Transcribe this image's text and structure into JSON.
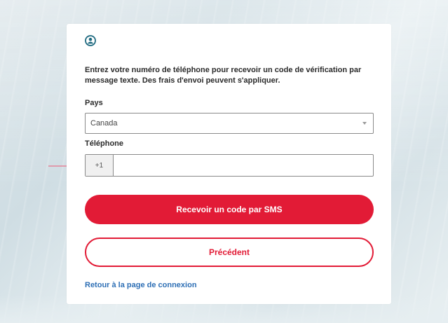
{
  "page": {
    "instructions": "Entrez votre numéro de téléphone pour recevoir un code de vérification par message texte. Des frais d'envoi peuvent s'appliquer.",
    "icons": {
      "user": "user-circle-icon",
      "annotation_arrow": "arrow-right-icon",
      "select_caret": "chevron-down-icon"
    }
  },
  "form": {
    "country_label": "Pays",
    "country_value": "Canada",
    "phone_label": "Téléphone",
    "phone_prefix": "+1",
    "phone_value": ""
  },
  "actions": {
    "send_sms": "Recevoir un code par SMS",
    "previous": "Précédent",
    "back_to_login": "Retour à la page de connexion"
  },
  "colors": {
    "accent": "#e21b36",
    "link": "#2e6fb5",
    "annotation_arrow": "#e8728a",
    "icon": "#1f6a80"
  }
}
